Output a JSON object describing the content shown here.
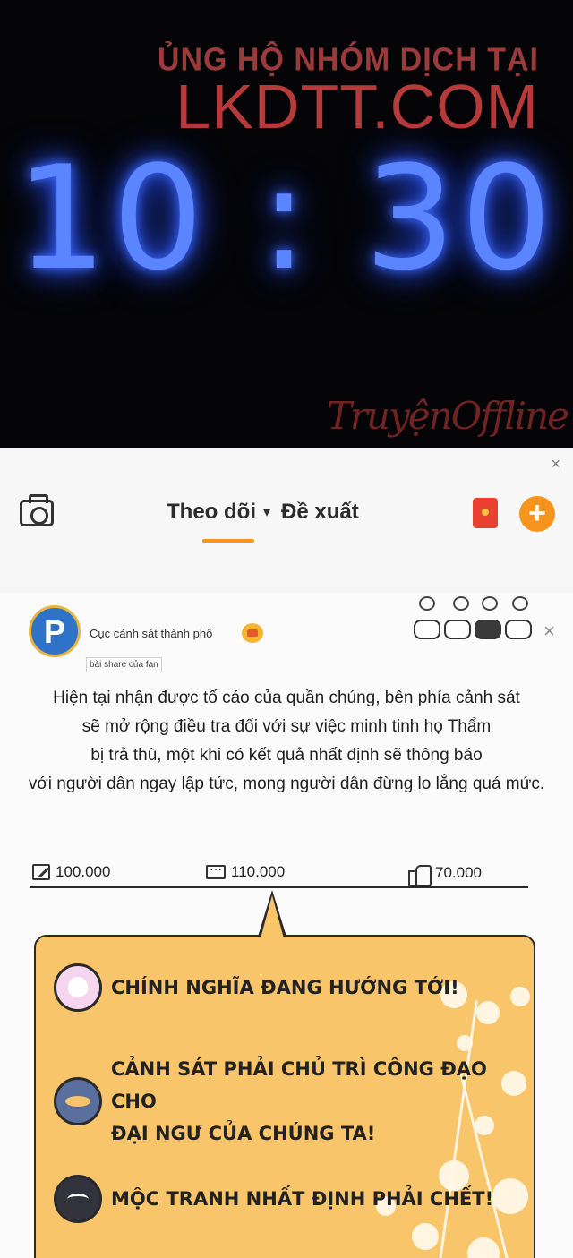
{
  "watermark": {
    "line1": "ỦNG HỘ NHÓM DỊCH TẠI",
    "line2": "LKDTT.COM",
    "signature": "TruyệnOffline"
  },
  "clock": {
    "time": "10 : 30"
  },
  "header": {
    "close_icon": "×",
    "tab_follow": "Theo dõi",
    "caret": "▾",
    "tab_suggest": "Đề xuất",
    "plus": "+"
  },
  "post": {
    "author": "Cục cảnh sát thành phố",
    "share_tag": "bài share của fan",
    "text_lines": [
      "Hiện tại nhận được tố cáo của quần chúng, bên phía cảnh sát",
      "sẽ mở rộng điều tra đối với sự việc minh tinh họ Thẩm",
      "bị trả thù, một khi có kết quả nhất định sẽ thông báo",
      "với người dân ngay lập tức, mong người dân đừng lo lắng quá mức."
    ],
    "stats": {
      "shares": "100.000",
      "comments": "110.000",
      "likes": "70.000"
    }
  },
  "comments": [
    {
      "text": "CHÍNH NGHĨA ĐANG HƯỚNG TỚI!"
    },
    {
      "text_line1": "CẢNH SÁT PHẢI CHỦ TRÌ CÔNG ĐẠO CHO",
      "text_line2": "ĐẠI NGƯ CỦA CHÚNG TA!"
    },
    {
      "text": "MỘC TRANH NHẤT ĐỊNH PHẢI CHẾT!"
    }
  ],
  "colors": {
    "accent": "#f7941d",
    "clock": "#5b84ff",
    "bubble": "#f9c56b",
    "watermark": "#b53a3a"
  }
}
